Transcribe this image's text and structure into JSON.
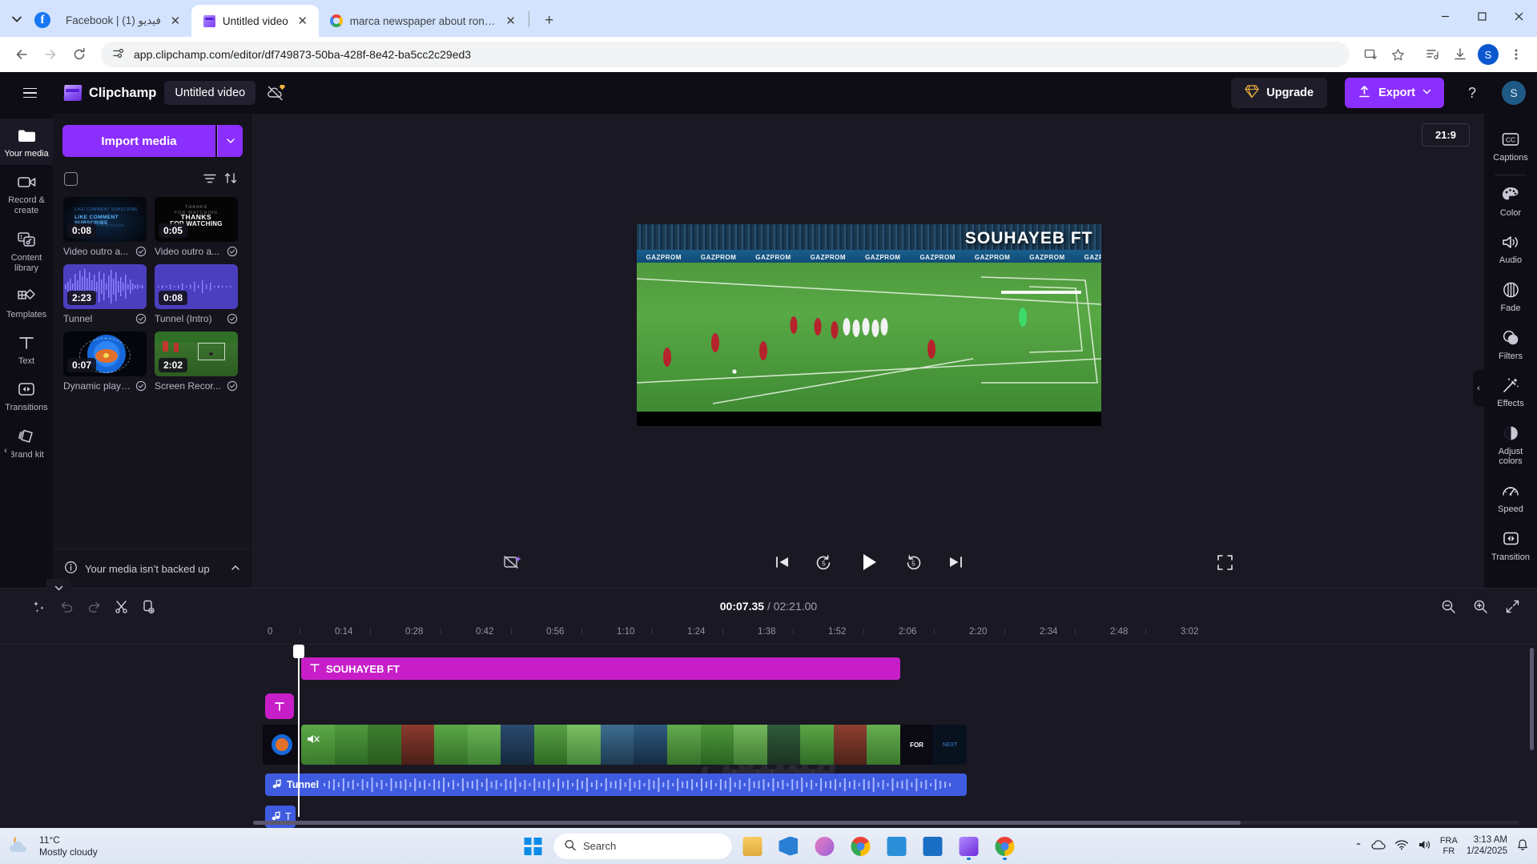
{
  "browser": {
    "tabs": [
      {
        "title": "Facebook | فيديو (1)",
        "favicon": "facebook-icon",
        "active": false
      },
      {
        "title": "Untitled video",
        "favicon": "clipchamp-icon",
        "active": true
      },
      {
        "title": "marca newspaper about ronaldo",
        "favicon": "google-icon",
        "active": false
      }
    ],
    "new_tab_label": "+",
    "close_label": "✕",
    "url": "app.clipchamp.com/editor/df749873-50ba-428f-8e42-ba5cc2c29ed3",
    "profile_initial": "S",
    "window_controls": {
      "minimize": "—",
      "maximize": "▢",
      "close": "✕"
    }
  },
  "app_header": {
    "brand": "Clipchamp",
    "project_title": "Untitled video",
    "upgrade_label": "Upgrade",
    "export_label": "Export",
    "help_label": "?",
    "avatar_initial": "S"
  },
  "left_rail": {
    "items": [
      {
        "label": "Your media",
        "icon": "folder-icon",
        "active": true
      },
      {
        "label": "Record & create",
        "icon": "video-camera-icon",
        "active": false
      },
      {
        "label": "Content library",
        "icon": "content-library-icon",
        "active": false
      },
      {
        "label": "Templates",
        "icon": "templates-icon",
        "active": false
      },
      {
        "label": "Text",
        "icon": "text-icon",
        "active": false
      },
      {
        "label": "Transitions",
        "icon": "transitions-icon",
        "active": false
      },
      {
        "label": "Brand kit",
        "icon": "brand-kit-icon",
        "active": false
      }
    ]
  },
  "media_panel": {
    "import_label": "Import media",
    "import_caret": "▾",
    "filter_icon": "filter-icon",
    "sort_icon": "sort-icon",
    "items": [
      {
        "name": "Video outro a...",
        "duration": "0:08",
        "thumb": "outro-subscribe",
        "checked": true
      },
      {
        "name": "Video outro a...",
        "duration": "0:05",
        "thumb": "outro-thanks",
        "checked": true
      },
      {
        "name": "Tunnel",
        "duration": "2:23",
        "thumb": "audio-waveform",
        "checked": true
      },
      {
        "name": "Tunnel (Intro)",
        "duration": "0:08",
        "thumb": "audio-waveform-flat",
        "checked": true
      },
      {
        "name": "Dynamic play ...",
        "duration": "0:07",
        "thumb": "dynamic-play",
        "checked": true
      },
      {
        "name": "Screen Recor...",
        "duration": "2:02",
        "thumb": "screen-recording",
        "checked": true
      }
    ],
    "footer_text": "Your media isn’t backed up",
    "footer_icon": "info-icon",
    "footer_caret": "⌃"
  },
  "preview": {
    "aspect_ratio": "21:9",
    "overlay_title": "SOUHAYEB FT",
    "ad_boards": [
      "GAZPROM",
      "GAZPROM",
      "GAZPROM",
      "GAZPROM",
      "GAZPROM",
      "GAZPROM",
      "GAZPROM",
      "GAZPROM",
      "GAZPROM"
    ],
    "controls": {
      "remove_bg": "remove-background-icon",
      "skip_start": "skip-to-start-icon",
      "back5": "back-5-seconds-icon",
      "play": "play-icon",
      "forward5": "forward-5-seconds-icon",
      "skip_end": "skip-to-end-icon",
      "fullscreen": "fullscreen-icon",
      "back5_label": "5",
      "forward5_label": "5"
    }
  },
  "right_rail": {
    "items": [
      {
        "label": "Captions",
        "icon": "captions-icon"
      },
      {
        "label": "Color",
        "icon": "color-palette-icon"
      },
      {
        "label": "Audio",
        "icon": "audio-speaker-icon"
      },
      {
        "label": "Fade",
        "icon": "fade-icon"
      },
      {
        "label": "Filters",
        "icon": "filters-icon"
      },
      {
        "label": "Effects",
        "icon": "effects-wand-icon"
      },
      {
        "label": "Adjust colors",
        "icon": "adjust-colors-icon"
      },
      {
        "label": "Speed",
        "icon": "speed-gauge-icon"
      },
      {
        "label": "Transition",
        "icon": "transition-icon"
      }
    ]
  },
  "timeline": {
    "toolbar": {
      "magic_icon": "magic-wand-icon",
      "undo_icon": "undo-icon",
      "redo_icon": "redo-icon",
      "split_icon": "scissors-icon",
      "duplicate_icon": "duplicate-icon",
      "zoom_out_icon": "zoom-out-icon",
      "zoom_in_icon": "zoom-in-icon",
      "fit_icon": "fit-to-screen-icon"
    },
    "current_time": "00:07.35",
    "total_time": "/ 02:21.00",
    "ruler_ticks": [
      "0",
      "0:14",
      "0:28",
      "0:42",
      "0:56",
      "1:10",
      "1:24",
      "1:38",
      "1:52",
      "2:06",
      "2:20",
      "2:34",
      "2:48",
      "3:02"
    ],
    "clips": {
      "text_clip_label": "SOUHAYEB FT",
      "text_clip_icon": "text-icon",
      "text_track_badge": "text-track-icon",
      "video_mute_icon": "audio-muted-icon",
      "audio_clip_label": "Tunnel",
      "audio_clip_icon": "music-note-icon",
      "audio_clip2_icon": "music-note-icon",
      "audio_clip2_label": "T"
    },
    "watermark": "مستقل"
  },
  "taskbar": {
    "weather_temp": "11°C",
    "weather_desc": "Mostly cloudy",
    "weather_icon": "cloudy-icon",
    "start_icon": "windows-start-icon",
    "search_placeholder": "Search",
    "search_icon": "search-icon",
    "apps": [
      {
        "name": "file-explorer",
        "color": "#f3c14a"
      },
      {
        "name": "vs-code",
        "color": "#2a7fd4"
      },
      {
        "name": "paint",
        "color": "#d86ab0"
      },
      {
        "name": "chrome-secondary",
        "color": "#4285f4"
      },
      {
        "name": "microsoft-store",
        "color": "#2b8fd8"
      },
      {
        "name": "outlook",
        "color": "#1a6fc4"
      },
      {
        "name": "clipchamp-app",
        "color": "#8b5cf6"
      },
      {
        "name": "chrome-active",
        "color": "#4285f4"
      }
    ],
    "tray": {
      "chevron": "⌃",
      "onedrive_icon": "onedrive-icon",
      "wifi_icon": "wifi-icon",
      "volume_icon": "volume-icon",
      "lang_line1": "FRA",
      "lang_line2": "FR",
      "time": "3:13 AM",
      "date": "1/24/2025",
      "notify_icon": "notifications-icon"
    }
  }
}
